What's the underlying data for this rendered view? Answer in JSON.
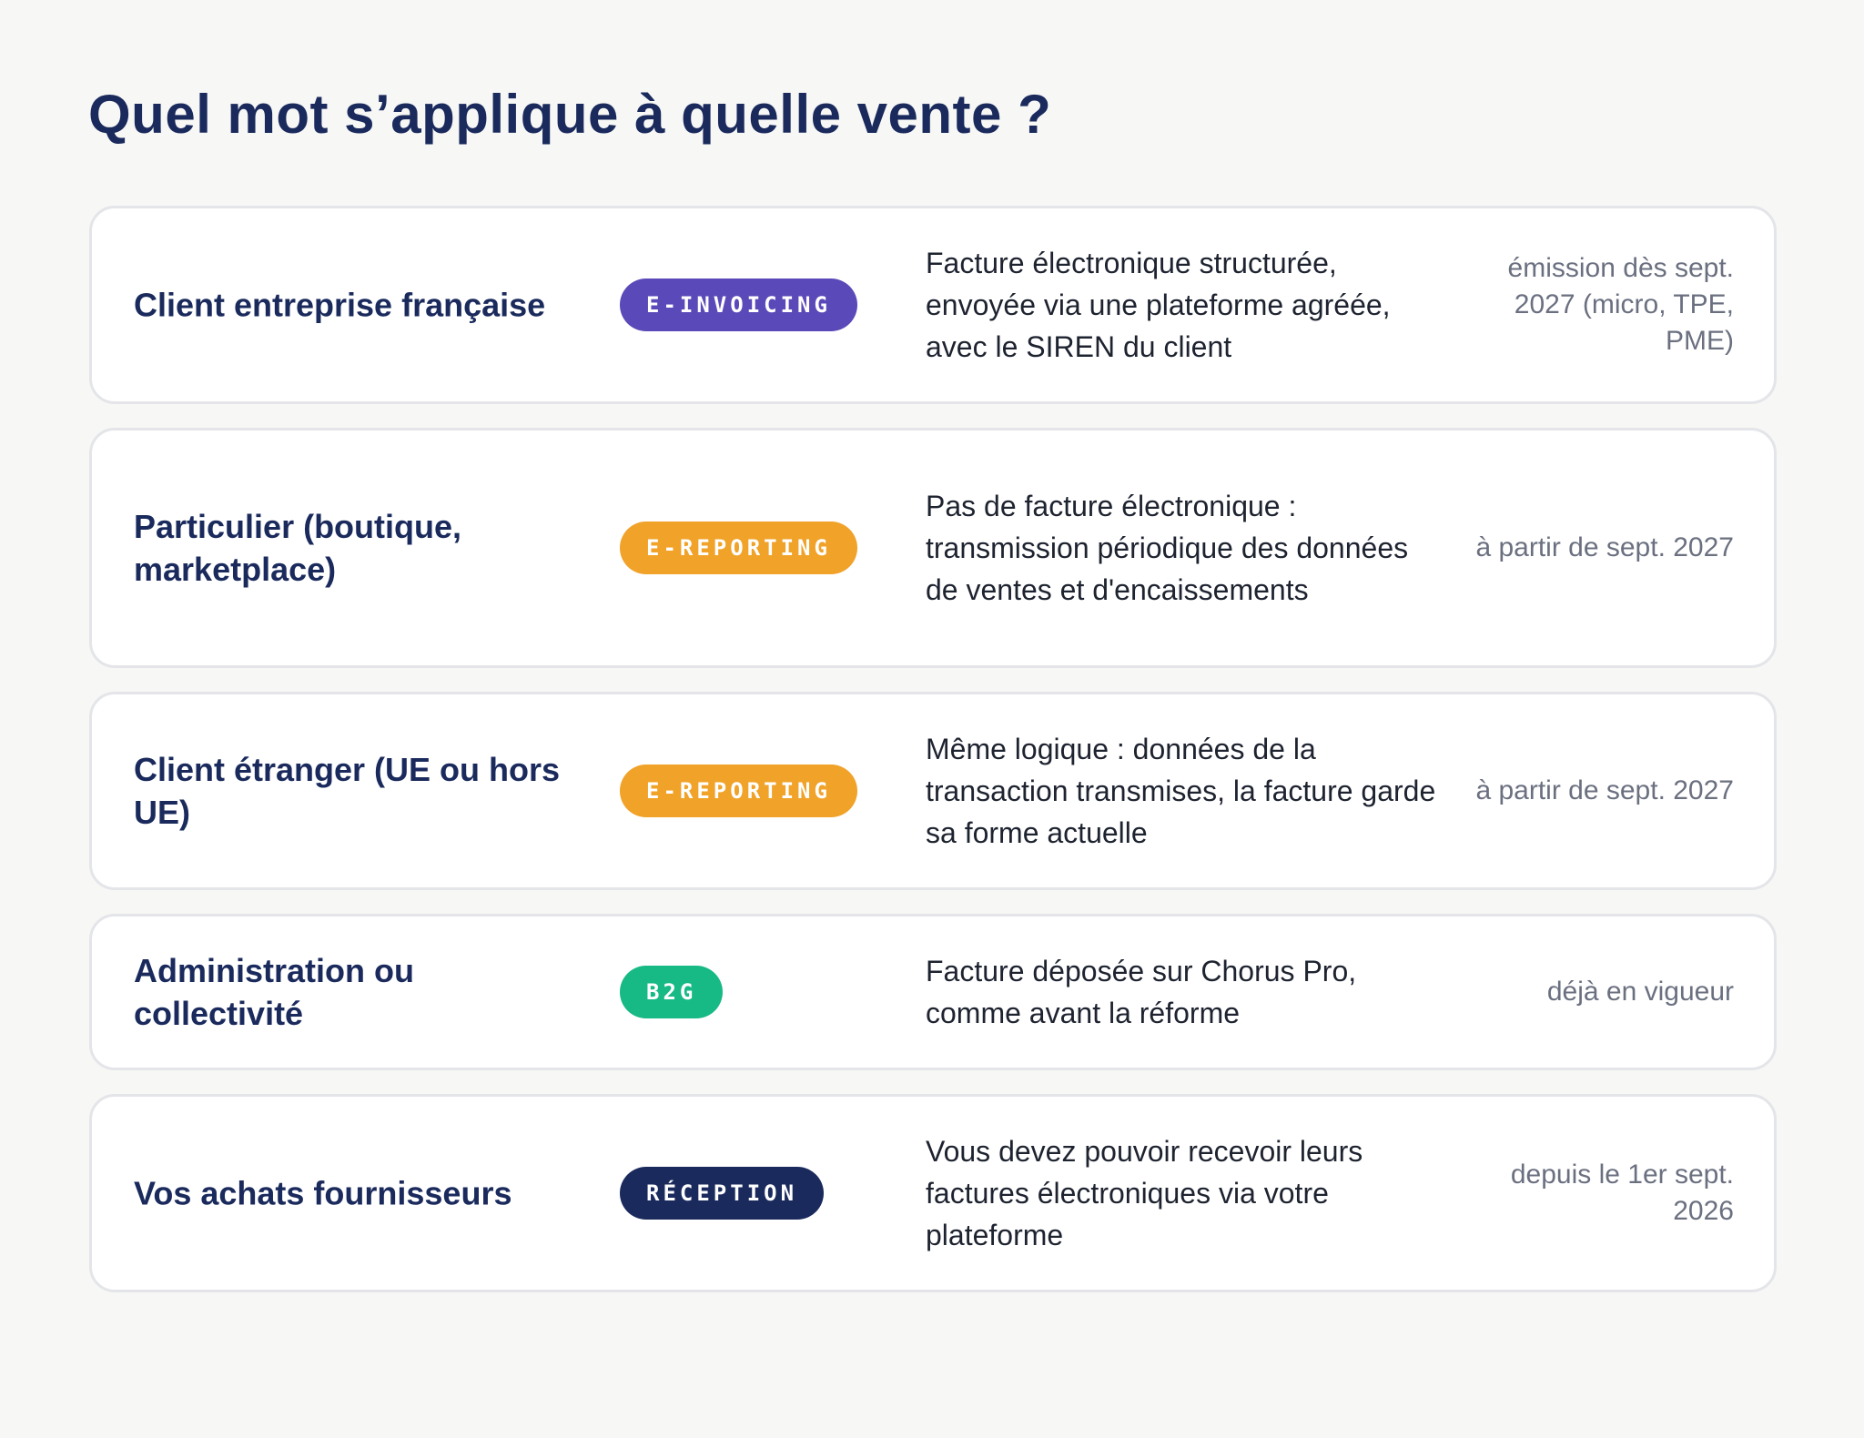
{
  "title": "Quel mot s’applique à quelle vente ?",
  "colors": {
    "e_invoicing": "#5a49b8",
    "e_reporting": "#f0a229",
    "b2g": "#17b985",
    "reception": "#1a2a5c",
    "heading": "#1a2a5c"
  },
  "rows": [
    {
      "label": "Client entreprise française",
      "badge": "E-INVOICING",
      "description": "Facture électronique structurée, envoyée via une plateforme agréée, avec le SIREN du client",
      "date": "émission dès sept. 2027 (micro, TPE, PME)"
    },
    {
      "label": "Particulier (boutique, marketplace)",
      "badge": "E-REPORTING",
      "description": "Pas de facture électronique : transmission périodique des données de ventes et d'encaissements",
      "date": "à partir de sept. 2027"
    },
    {
      "label": "Client étranger (UE ou hors UE)",
      "badge": "E-REPORTING",
      "description": "Même logique : données de la transaction transmises, la facture garde sa forme actuelle",
      "date": "à partir de sept. 2027"
    },
    {
      "label": "Administration ou collectivité",
      "badge": "B2G",
      "description": "Facture déposée sur Chorus Pro, comme avant la réforme",
      "date": "déjà en vigueur"
    },
    {
      "label": "Vos achats fournisseurs",
      "badge": "RÉCEPTION",
      "description": "Vous devez pouvoir recevoir leurs factures électroniques via votre plateforme",
      "date": "depuis le 1er sept. 2026"
    }
  ]
}
